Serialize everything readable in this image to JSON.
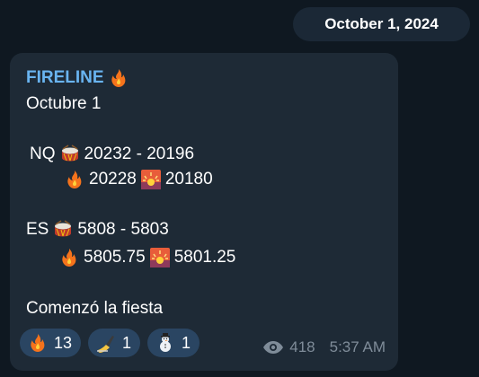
{
  "date_label": "October 1, 2024",
  "message": {
    "sender": "FIRELINE",
    "lines": {
      "date": "Octubre 1",
      "nq_label": "NQ",
      "nq_range": "20232 - 20196",
      "nq_fire_value": "20228",
      "nq_sunset_value": "20180",
      "es_label": "ES",
      "es_range": "5808 - 5803",
      "es_fire_value": "5805.75",
      "es_sunset_value": "5801.25",
      "closing": "Comenzó la fiesta"
    },
    "reactions": [
      {
        "icon": "fire-icon",
        "count": "13"
      },
      {
        "icon": "writing-hand-icon",
        "count": "1"
      },
      {
        "icon": "snowman-icon",
        "count": "1"
      }
    ],
    "views": "418",
    "time": "5:37 AM"
  },
  "colors": {
    "background": "#0f1821",
    "bubble": "#1e2a36",
    "date_pill": "#1b2836",
    "sender": "#69b4f0",
    "reaction_bg": "#2a4562",
    "meta": "#7f8c99"
  }
}
